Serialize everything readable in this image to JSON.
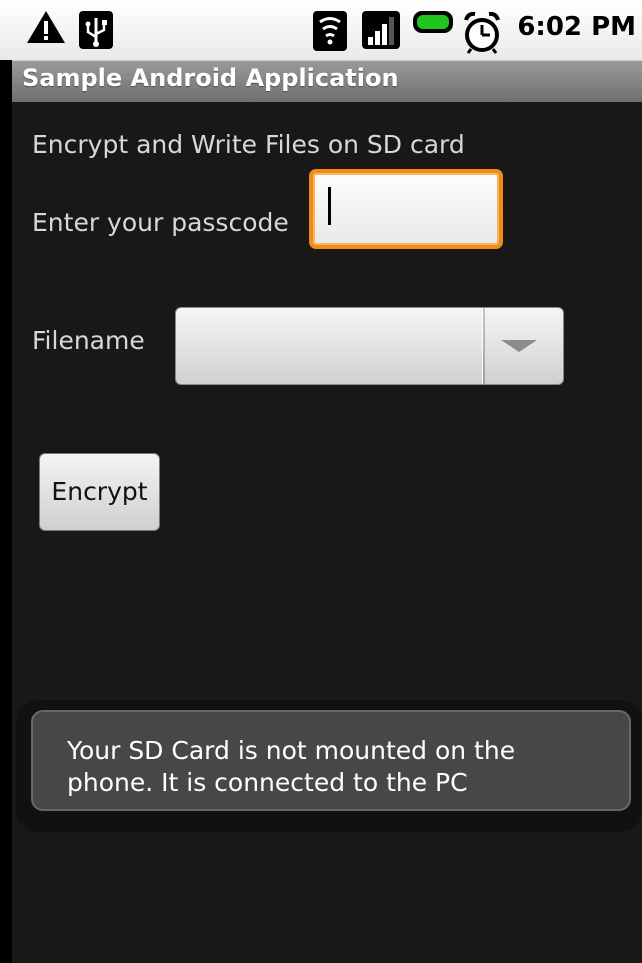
{
  "status_bar": {
    "time": "6:02 PM",
    "icons": [
      "warning-icon",
      "usb-icon",
      "wifi-icon",
      "signal-icon",
      "battery-icon",
      "alarm-icon"
    ],
    "battery_color": "#22c41e"
  },
  "app": {
    "title": "Sample Android Application"
  },
  "main": {
    "heading": "Encrypt and Write Files on SD card",
    "passcode_label": "Enter your passcode",
    "passcode_value": "",
    "filename_label": "Filename",
    "filename_selected": "",
    "encrypt_label": "Encrypt"
  },
  "toast": {
    "line1": "Your SD Card is not mounted on the",
    "line2": "phone. It is connected to the PC"
  },
  "colors": {
    "focus_border": "#f08a18",
    "background": "#181818",
    "text": "#d8d8d8"
  }
}
